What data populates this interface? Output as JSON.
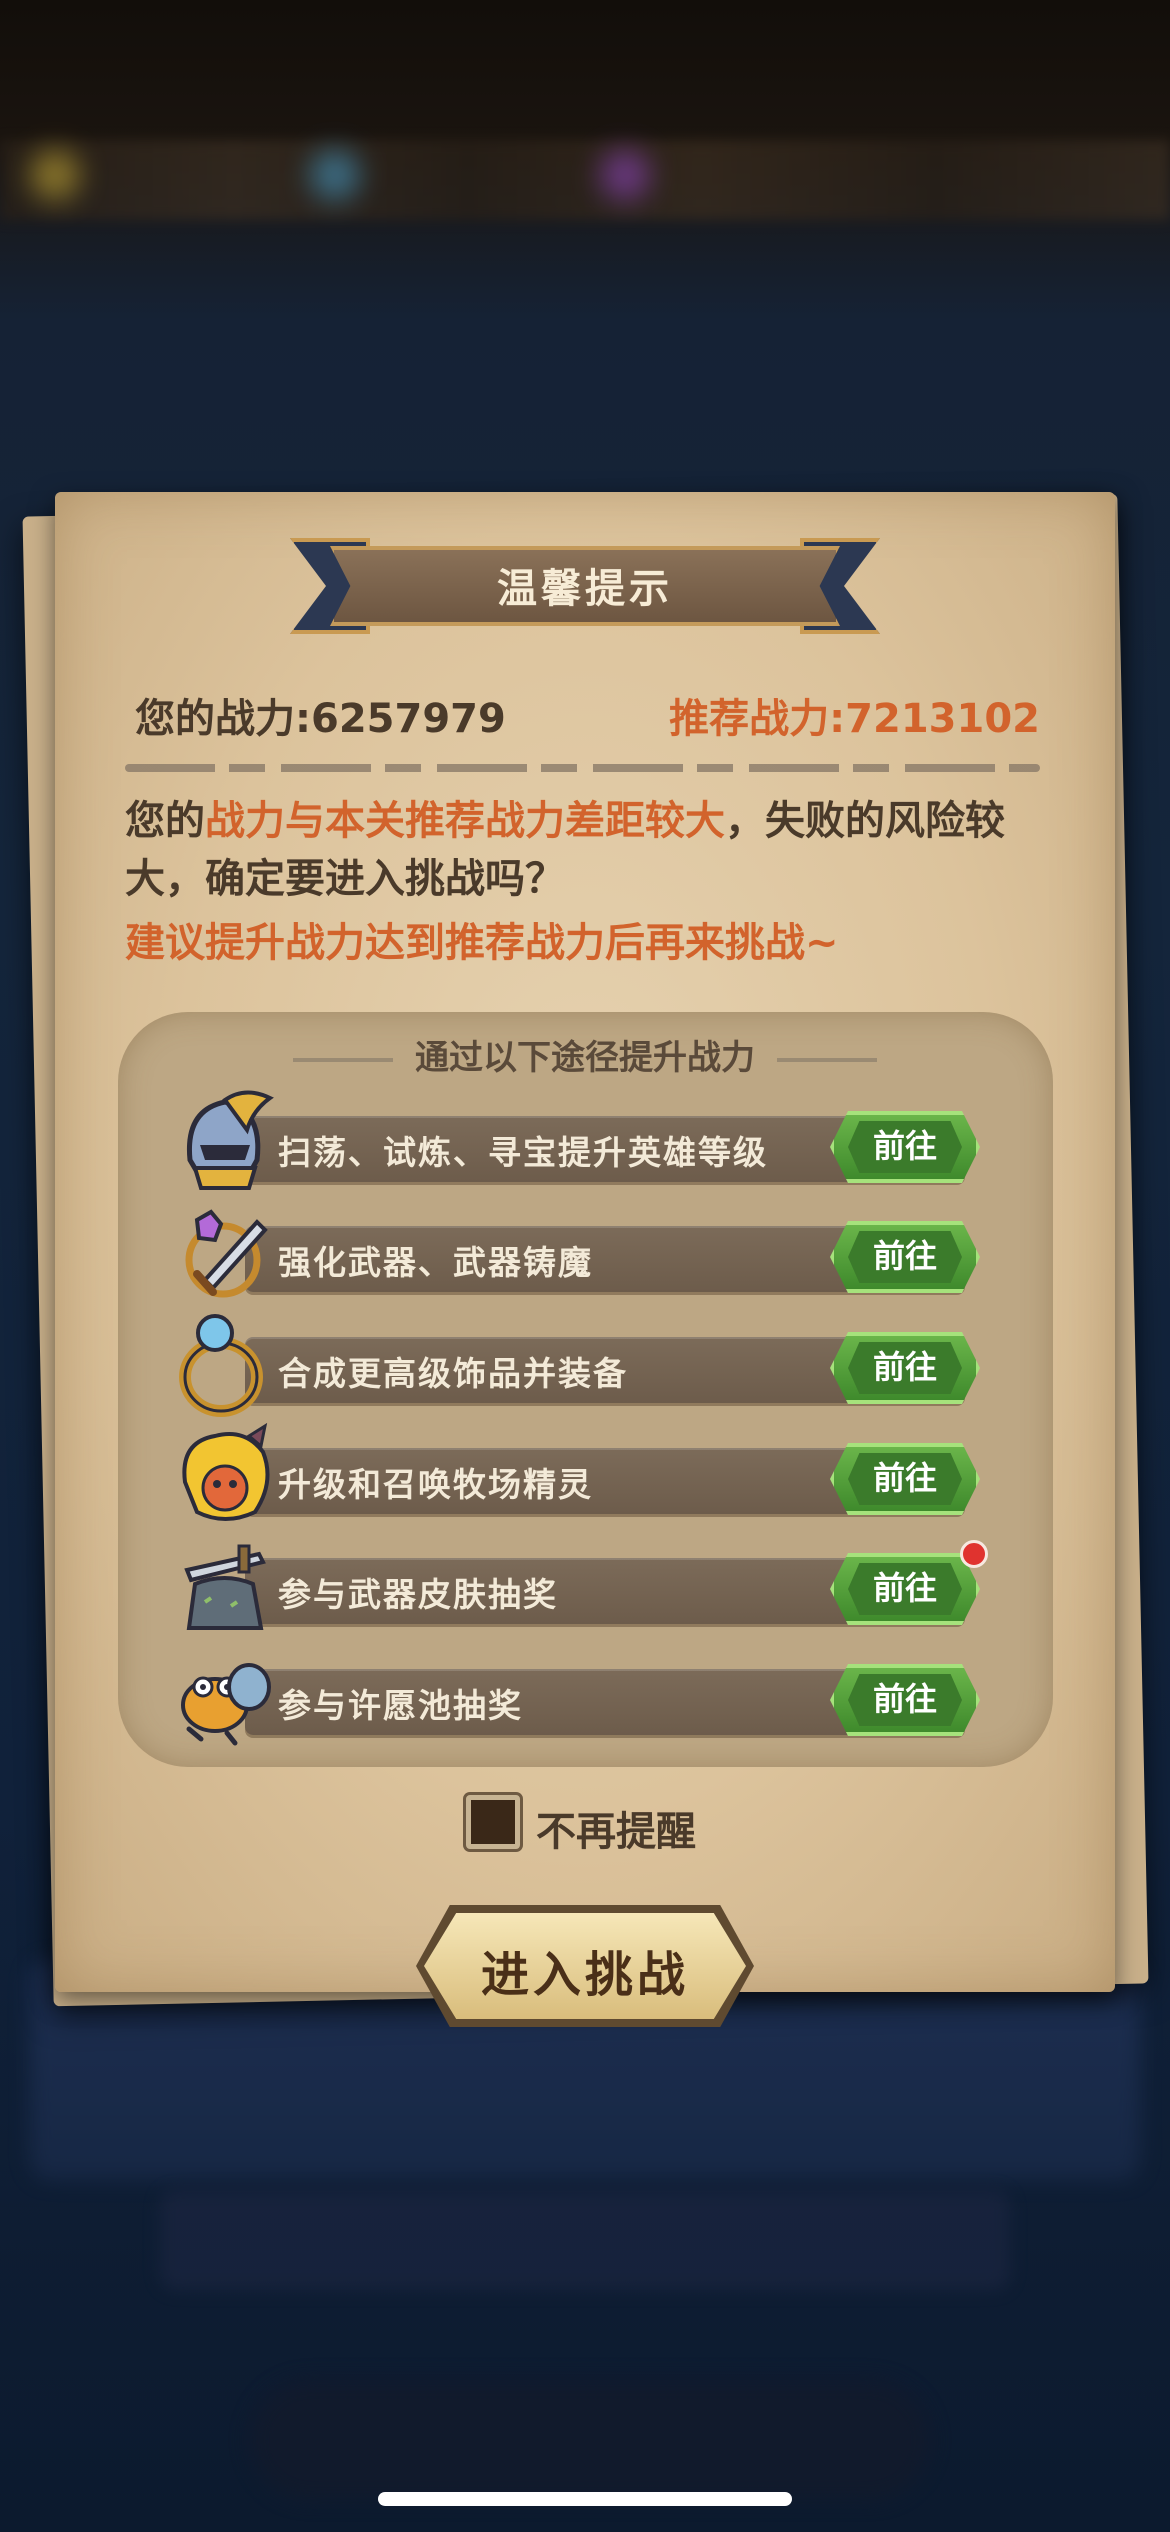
{
  "dialog": {
    "title": "温馨提示",
    "my_power": "您的战力:6257979",
    "recommended_power": "推荐战力:7213102",
    "message_prefix": "您的",
    "message_highlight": "战力与本关推荐战力差距较大",
    "message_suffix": "，失败的风险较大，确定要进入挑战吗？",
    "suggestion": "建议提升战力达到推荐战力后再来挑战~"
  },
  "ways": {
    "title": "通过以下途径提升战力",
    "go_label": "前往",
    "items": [
      {
        "label": "扫荡、试炼、寻宝提升英雄等级",
        "icon": "helmet-icon"
      },
      {
        "label": "强化武器、武器铸魔",
        "icon": "sword-icon"
      },
      {
        "label": "合成更高级饰品并装备",
        "icon": "ring-icon"
      },
      {
        "label": "升级和召唤牧场精灵",
        "icon": "pet-icon"
      },
      {
        "label": "参与武器皮肤抽奖",
        "icon": "weapon-skin-icon",
        "has_notification": true
      },
      {
        "label": "参与许愿池抽奖",
        "icon": "wishing-frog-icon"
      }
    ]
  },
  "options": {
    "dont_remind_label": "不再提醒"
  },
  "actions": {
    "enter_label": "进入挑战"
  },
  "colors": {
    "accent_orange": "#d2632c",
    "go_green": "#4f9c38",
    "paper": "#dcc39c"
  }
}
